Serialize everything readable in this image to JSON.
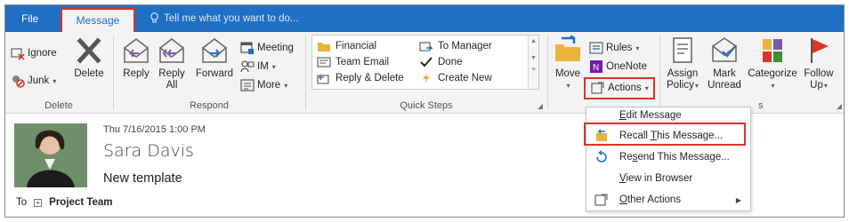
{
  "tabs": {
    "file": "File",
    "message": "Message"
  },
  "tell_me": "Tell me what you want to do...",
  "delete_group": {
    "ignore": "Ignore",
    "junk": "Junk",
    "delete": "Delete",
    "label": "Delete"
  },
  "respond_group": {
    "reply": "Reply",
    "reply_all_line1": "Reply",
    "reply_all_line2": "All",
    "forward": "Forward",
    "meeting": "Meeting",
    "im": "IM",
    "more": "More",
    "label": "Respond"
  },
  "quick_steps": {
    "items": [
      "Financial",
      "Team Email",
      "Reply & Delete",
      "To Manager",
      "Done",
      "Create New"
    ],
    "label": "Quick Steps"
  },
  "move_group": {
    "move": "Move",
    "rules": "Rules",
    "onenote": "OneNote",
    "actions": "Actions"
  },
  "tags_group": {
    "assign_line1": "Assign",
    "assign_line2": "Policy",
    "mark_line1": "Mark",
    "mark_line2": "Unread",
    "categorize": "Categorize",
    "follow_line1": "Follow",
    "follow_line2": "Up",
    "label_fragment": "s"
  },
  "actions_menu": {
    "items": [
      {
        "label": "Edit Message",
        "access_key": "E",
        "icon": "edit-icon"
      },
      {
        "label": "Recall This Message...",
        "access_key": "T",
        "icon": "recall-icon"
      },
      {
        "label": "Resend This Message...",
        "access_key": "s",
        "icon": "resend-icon"
      },
      {
        "label": "View in Browser",
        "access_key": "V",
        "icon": "none"
      },
      {
        "label": "Other Actions",
        "access_key": "O",
        "icon": "other-actions-icon"
      }
    ]
  },
  "message": {
    "date": "Thu 7/16/2015 1:00 PM",
    "sender": "Sara Davis",
    "subject": "New template",
    "to_label": "To",
    "recipient": "Project Team"
  },
  "colors": {
    "accent": "#1f6fc4",
    "highlight": "#d9352b",
    "ribbon_bg": "#f3f3f3"
  }
}
